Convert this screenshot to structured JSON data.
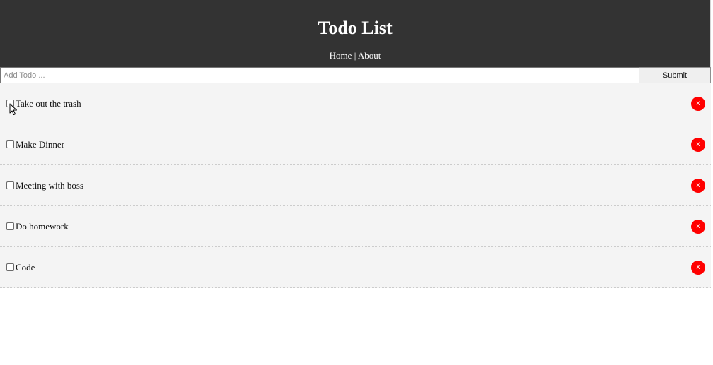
{
  "header": {
    "title": "Todo List",
    "nav": [
      {
        "label": "Home"
      },
      {
        "label": "About"
      }
    ],
    "separator": "|"
  },
  "add_form": {
    "placeholder": "Add Todo ...",
    "value": "",
    "submit_label": "Submit"
  },
  "todos": [
    {
      "title": "Take out the trash",
      "completed": false,
      "delete_label": "x"
    },
    {
      "title": "Make Dinner",
      "completed": false,
      "delete_label": "x"
    },
    {
      "title": "Meeting with boss",
      "completed": false,
      "delete_label": "x"
    },
    {
      "title": "Do homework",
      "completed": false,
      "delete_label": "x"
    },
    {
      "title": "Code",
      "completed": false,
      "delete_label": "x"
    }
  ],
  "colors": {
    "header_bg": "#333333",
    "item_bg": "#f4f4f4",
    "delete_bg": "#ff0000"
  },
  "icons": {
    "pointer": "mouse-pointer-icon",
    "delete": "delete-x-icon"
  }
}
